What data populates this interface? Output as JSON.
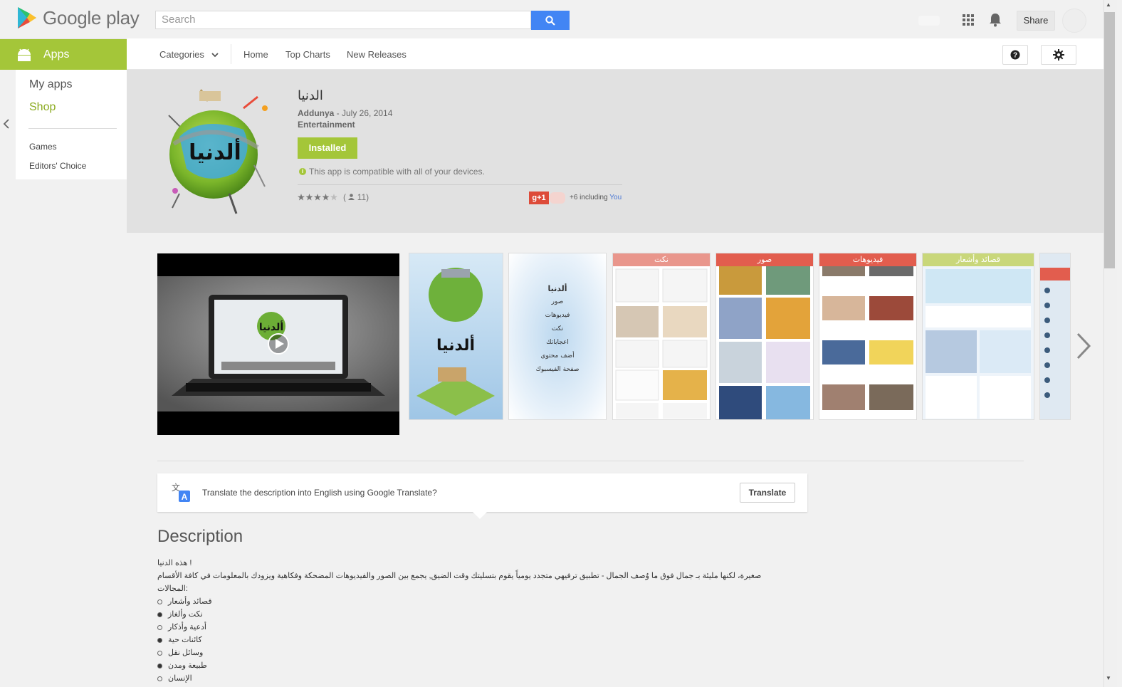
{
  "header": {
    "logo_text": "Google play",
    "search_placeholder": "Search",
    "share_label": "Share"
  },
  "nav": {
    "apps_label": "Apps",
    "categories_label": "Categories",
    "home_label": "Home",
    "top_charts_label": "Top Charts",
    "new_releases_label": "New Releases"
  },
  "sidebar": {
    "my_apps": "My apps",
    "shop": "Shop",
    "games": "Games",
    "editors_choice": "Editors' Choice"
  },
  "app": {
    "title": "الدنيا",
    "developer": "Addunya",
    "date": " - July 26, 2014",
    "category": "Entertainment",
    "installed_label": "Installed",
    "compat_text": "This app is compatible with all of your devices.",
    "rating_count": "11",
    "rating_stars": 4.5,
    "gplus_label": "g+1",
    "plus_text": "+6 including ",
    "plus_you": "You"
  },
  "translate": {
    "prompt": "Translate the description into English using Google Translate?",
    "button": "Translate"
  },
  "description": {
    "title": "Description",
    "line1": "! هذه الدنيا",
    "line2": "صغيرة، لكنها مليئة بـ جمال فوق ما وُصف الجمال - تطبيق ترفيهي متجدد يومياً يقوم بتسليتك وقت الضيق, يجمع بين الصور والفيديوهات المضحكة وفكاهية ويزودك بالمعلومات في كافة الأقسام",
    "line3": ":المجالات",
    "bullets": [
      {
        "text": "قصائد وأشعار",
        "filled": false
      },
      {
        "text": "نكت وألغاز",
        "filled": true
      },
      {
        "text": "أدعية وأذكار",
        "filled": false
      },
      {
        "text": "كائنات حية",
        "filled": true
      },
      {
        "text": "وسائل نقل",
        "filled": false
      },
      {
        "text": "طبيعة ومدن",
        "filled": true
      },
      {
        "text": "الإنسان",
        "filled": false
      }
    ]
  },
  "screenshots": {
    "labels": [
      "نكت",
      "صور",
      "فيديوهات",
      "قصائد وأشعار"
    ],
    "menu_items": [
      "ألدنيا",
      "صور",
      "فيديوهات",
      "نكت",
      "اعجاباتك",
      "أضف محتوى",
      "صفحة الفيسبوك"
    ],
    "splash_title": "ألدنيا",
    "video_title": "ألدنيا"
  },
  "colors": {
    "android_green": "#a4c639",
    "google_blue": "#4285f4",
    "gplus_red": "#dd4b39"
  }
}
